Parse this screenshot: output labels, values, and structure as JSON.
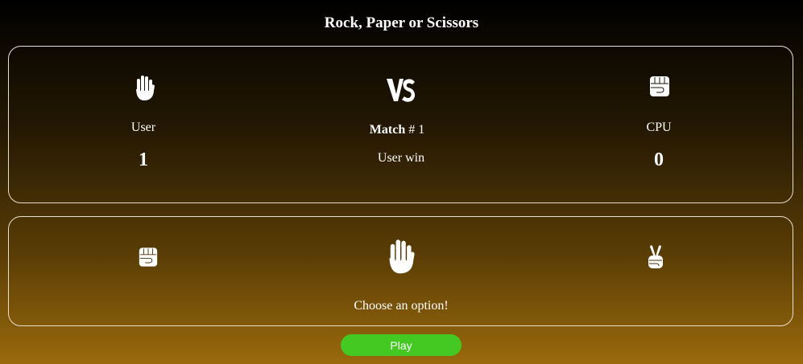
{
  "header": {
    "title": "Rock, Paper or Scissors"
  },
  "scoreboard": {
    "user": {
      "label": "User",
      "score": "1",
      "choice_icon": "paper-hand-icon"
    },
    "cpu": {
      "label": "CPU",
      "score": "0",
      "choice_icon": "rock-fist-icon"
    },
    "vs_icon": "vs-icon",
    "match_label": "Match",
    "match_number": "# 1",
    "result": "User win"
  },
  "options": {
    "items": [
      {
        "name": "rock",
        "icon": "rock-fist-icon"
      },
      {
        "name": "paper",
        "icon": "paper-hand-icon"
      },
      {
        "name": "scissors",
        "icon": "scissors-hand-icon"
      }
    ],
    "prompt": "Choose an option!"
  },
  "controls": {
    "play_label": "Play"
  },
  "colors": {
    "play_button": "#44c922",
    "border": "#e8e0d0"
  }
}
